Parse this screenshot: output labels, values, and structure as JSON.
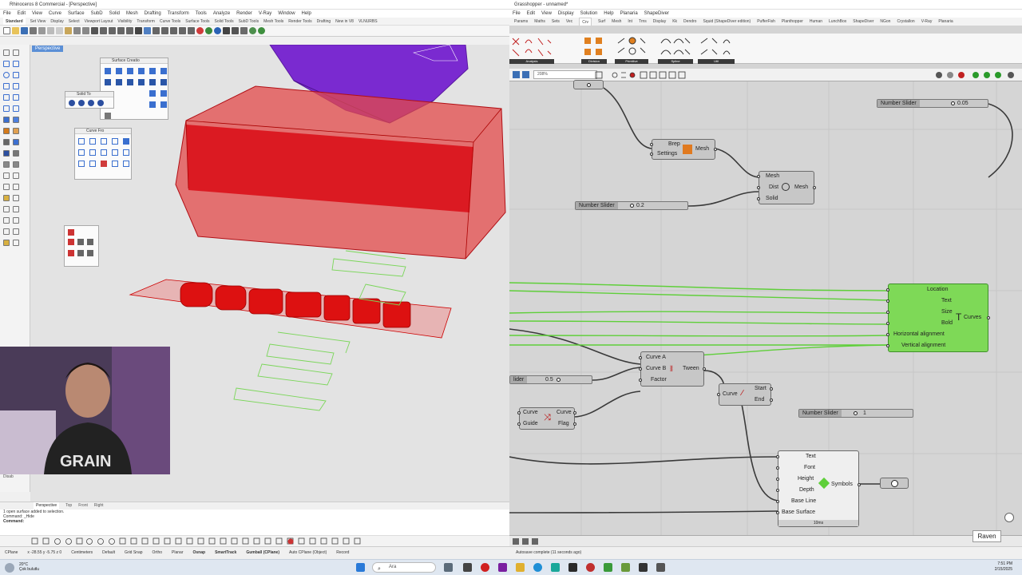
{
  "rhino": {
    "title": "Rhinoceros 8 Commercial - [Perspective]",
    "menu": [
      "File",
      "Edit",
      "View",
      "Curve",
      "Surface",
      "SubD",
      "Solid",
      "Mesh",
      "Drafting",
      "Transform",
      "Tools",
      "Analyze",
      "Render",
      "V-Ray",
      "Window",
      "Help"
    ],
    "tabs": [
      "Standard",
      "Set View",
      "Display",
      "Select",
      "Viewport Layout",
      "Visibility",
      "Transform",
      "Curve Tools",
      "Surface Tools",
      "Solid Tools",
      "SubD Tools",
      "Mesh Tools",
      "Render Tools",
      "Drafting",
      "New in V8",
      "VLNURBS"
    ],
    "viewport_label": "Perspective",
    "panels": {
      "surface": "Surface Creatio",
      "solid": "Solid To",
      "curve": "Curve Fro"
    },
    "command_lines": [
      "1 open surface added to selection.",
      "Command: _Hide",
      "Command:"
    ],
    "view_tabs": [
      "Perspective",
      "Top",
      "Front",
      "Right"
    ],
    "side_label": "Disab",
    "status": {
      "cplane": "CPlane",
      "coords": "x -28.55   y -5.75   z 0",
      "units": "Centimeters",
      "layer": "Default",
      "items": [
        "Grid Snap",
        "Ortho",
        "Planar",
        "Osnap",
        "SmartTrack",
        "Gumball (CPlane)",
        "Auto CPlane (Object)",
        "Record"
      ],
      "bold": [
        "Osnap",
        "SmartTrack",
        "Gumball (CPlane)"
      ]
    }
  },
  "gh": {
    "title": "Grasshopper - unnamed*",
    "menu": [
      "File",
      "Edit",
      "View",
      "Display",
      "Solution",
      "Help",
      "Planaria",
      "ShapeDiver"
    ],
    "tabs": [
      "Params",
      "Maths",
      "Sets",
      "Vec",
      "Crv",
      "Surf",
      "Mesh",
      "Int",
      "Trns",
      "Display",
      "Kk",
      "Dendro",
      "Squid (ShapeDiver edition)",
      "PufferFish",
      "Planthopper",
      "Human",
      "LunchBox",
      "ShapeDiver",
      "NGon",
      "Crystallon",
      "V-Ray",
      "Planaria"
    ],
    "active_tab": "Crv",
    "ribbon_groups": [
      "Analysis",
      "Division",
      "Primitive",
      "Spline",
      "Util"
    ],
    "zoom": "208%",
    "file_name": "unnamed",
    "components": {
      "brep_mesh": {
        "inputs": [
          "Brep",
          "Settings"
        ],
        "output": "Mesh"
      },
      "mesh_solid": {
        "inputs": [
          "Mesh",
          "Dist",
          "Solid"
        ],
        "output": "Mesh"
      },
      "text_curves": {
        "inputs": [
          "Location",
          "Text",
          "Size",
          "Bold",
          "Horizontal alignment",
          "Vertical alignment"
        ],
        "output": "Curves"
      },
      "tween": {
        "inputs": [
          "Curve A",
          "Curve B",
          "Factor"
        ],
        "output": "Tween"
      },
      "flip": {
        "inputs": [
          "Curve",
          "Guide"
        ],
        "outputs": [
          "Curve",
          "Flag"
        ]
      },
      "endpoints": {
        "input": "Curve",
        "outputs": [
          "Start",
          "End"
        ]
      },
      "symbols": {
        "inputs": [
          "Text",
          "Font",
          "Height",
          "Depth",
          "Base Line",
          "Base Surface"
        ],
        "output": "Symbols",
        "time": "10ms"
      }
    },
    "sliders": [
      {
        "name": "Number Slider",
        "value": "0.05"
      },
      {
        "name": "Number Slider",
        "value": "0.2"
      },
      {
        "name": "lider",
        "value": "0.5"
      },
      {
        "name": "Number Slider",
        "value": "1"
      }
    ],
    "autosave": "Autosave complete (11 seconds ago)",
    "raven": "Raven"
  },
  "taskbar": {
    "weather_temp": "20°C",
    "weather_desc": "Çok bulutlu",
    "search_placeholder": "Ara",
    "time": "7:51 PM",
    "date": "2/15/2025"
  },
  "colors": {
    "text_component": "#7ed957",
    "wire_green": "#5fcf3a",
    "red_solid": "#d9111a",
    "purple": "#7a2ad0"
  }
}
